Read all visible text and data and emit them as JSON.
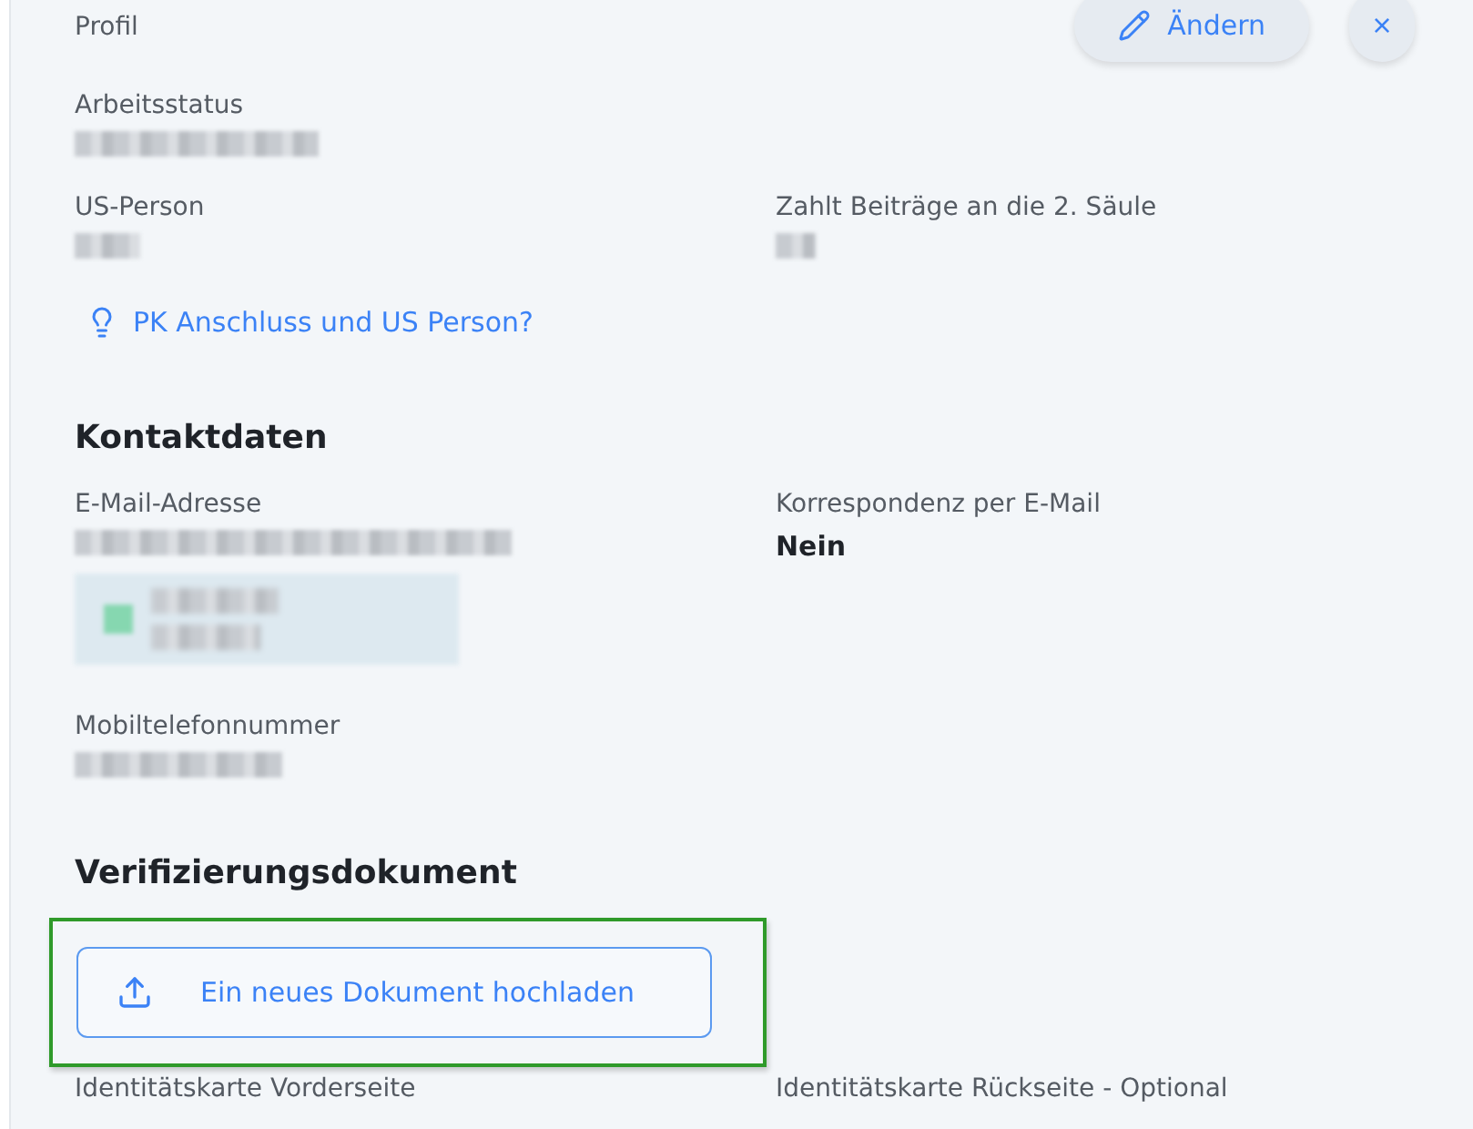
{
  "header": {
    "title": "Profil",
    "edit_button": "Ändern",
    "close_button": "×"
  },
  "profile_rows": [
    [
      {
        "label": "Arbeitsstatus",
        "kind": "redacted"
      }
    ],
    [
      {
        "label": "US-Person",
        "kind": "redacted"
      },
      {
        "label": "Zahlt Beiträge an die 2. Säule",
        "kind": "redacted"
      }
    ]
  ],
  "info_link": "PK Anschluss und US Person?",
  "contact": {
    "heading": "Kontaktdaten",
    "email": {
      "label": "E-Mail-Adresse",
      "kind": "redacted"
    },
    "correspondence": {
      "label": "Korrespondenz per E-Mail",
      "kind": "text",
      "value": "Nein"
    },
    "mobile": {
      "label": "Mobiltelefonnummer",
      "kind": "redacted"
    }
  },
  "verification": {
    "heading": "Verifizierungsdokument",
    "upload_button": {
      "label": "Ein neues Dokument hochladen",
      "highlighted": true
    },
    "columns": [
      "Identitätskarte Vorderseite",
      "Identitätskarte Rückseite - Optional"
    ]
  }
}
